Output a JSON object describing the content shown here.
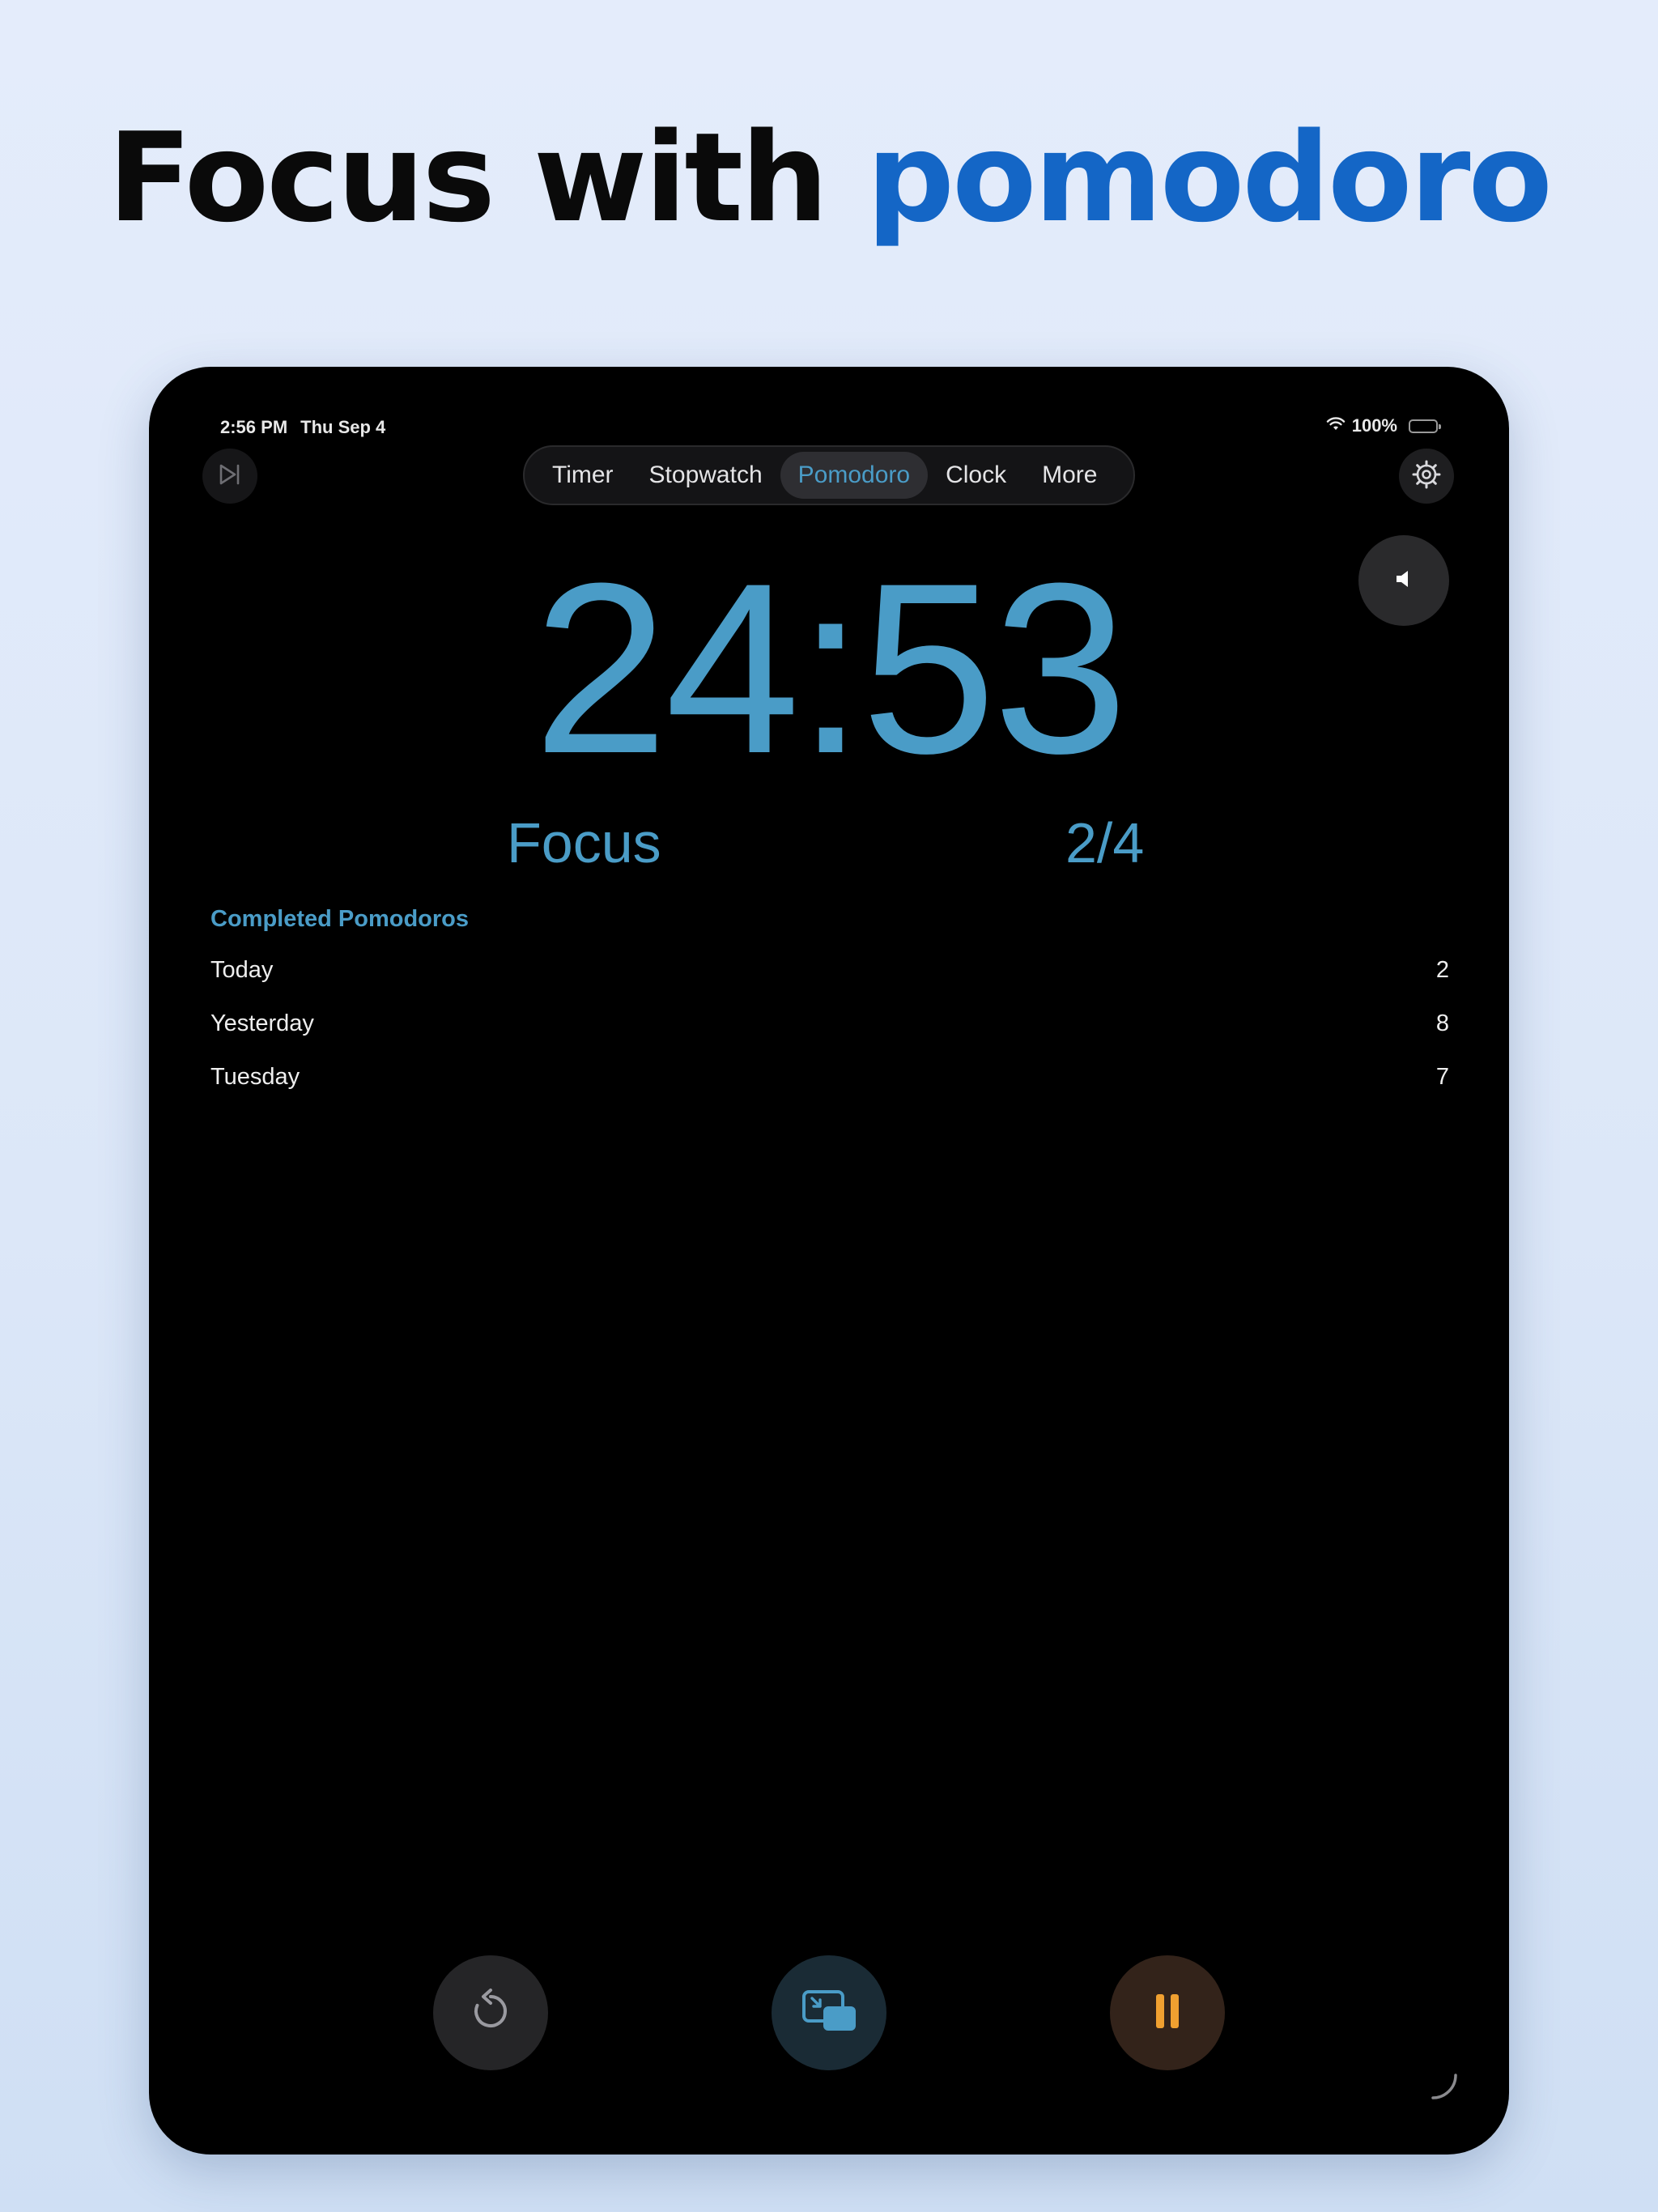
{
  "headline": {
    "prefix": "Focus with",
    "accent": "pomodoro"
  },
  "status_bar": {
    "time": "2:56 PM",
    "date": "Thu Sep 4",
    "battery": "100%",
    "wifi_icon": "wifi-icon",
    "battery_icon": "battery-icon"
  },
  "tabs": [
    {
      "label": "Timer",
      "active": false
    },
    {
      "label": "Stopwatch",
      "active": false
    },
    {
      "label": "Pomodoro",
      "active": true
    },
    {
      "label": "Clock",
      "active": false
    },
    {
      "label": "More",
      "active": false
    }
  ],
  "timer": {
    "time": "24:53",
    "phase": "Focus",
    "round": "2/4"
  },
  "completed": {
    "title": "Completed Pomodoros",
    "rows": [
      {
        "day": "Today",
        "count": "2"
      },
      {
        "day": "Yesterday",
        "count": "8"
      },
      {
        "day": "Tuesday",
        "count": "7"
      }
    ]
  },
  "controls": {
    "reset_icon": "reset-icon",
    "pip_icon": "picture-in-picture-icon",
    "pause_icon": "pause-icon",
    "sound_icon": "speaker-icon",
    "skip_icon": "skip-forward-icon",
    "settings_icon": "gear-icon"
  },
  "colors": {
    "accent": "#4a9cc7",
    "headline_accent": "#1466c6",
    "pause": "#f0a030"
  }
}
